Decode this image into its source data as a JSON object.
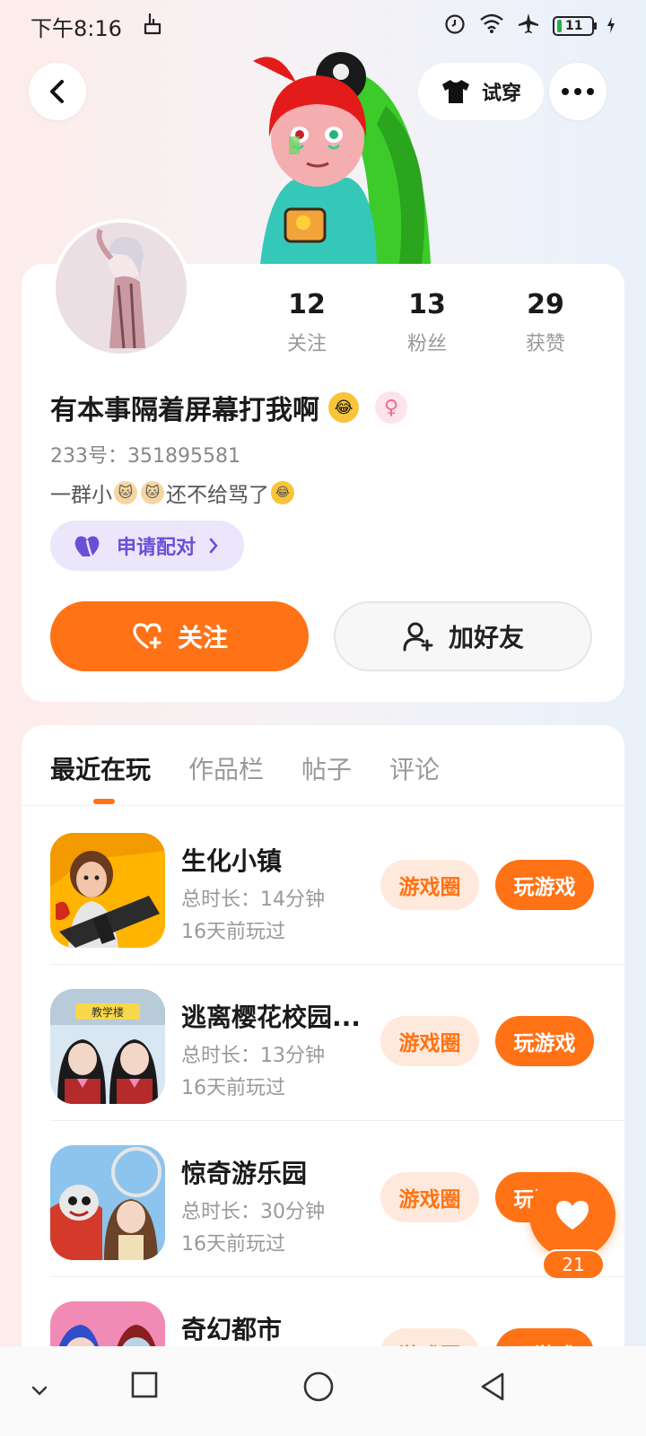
{
  "status_bar": {
    "time": "下午8:16",
    "battery": "11"
  },
  "header": {
    "tryon_label": "试穿"
  },
  "profile": {
    "stats": [
      {
        "value": "12",
        "label": "关注"
      },
      {
        "value": "13",
        "label": "粉丝"
      },
      {
        "value": "29",
        "label": "获赞"
      }
    ],
    "username": "有本事隔着屏幕打我啊",
    "uid": "233号：351895581",
    "bio_prefix": "一群小",
    "bio_suffix": "还不给骂了",
    "pair_label": "申请配对",
    "follow_label": "关注",
    "add_friend_label": "加好友"
  },
  "tabs": [
    {
      "label": "最近在玩",
      "active": true
    },
    {
      "label": "作品栏",
      "active": false
    },
    {
      "label": "帖子",
      "active": false
    },
    {
      "label": "评论",
      "active": false
    }
  ],
  "games": [
    {
      "name": "生化小镇",
      "duration": "总时长：14分钟",
      "last_played": "16天前玩过",
      "circle": "游戏圈",
      "play": "玩游戏"
    },
    {
      "name": "逃离樱花校园...",
      "duration": "总时长：13分钟",
      "last_played": "16天前玩过",
      "circle": "游戏圈",
      "play": "玩游戏",
      "icon_sign": "教学楼"
    },
    {
      "name": "惊奇游乐园",
      "duration": "总时长：30分钟",
      "last_played": "16天前玩过",
      "circle": "游戏圈",
      "play": "玩游戏"
    },
    {
      "name": "奇幻都市",
      "duration": "",
      "last_played": "",
      "circle": "游戏圈",
      "play": "玩游戏"
    }
  ],
  "like": {
    "count": "21"
  },
  "colors": {
    "accent": "#ff7215",
    "pair_purple": "#6a4fd8",
    "gender_pink": "#f06a91"
  }
}
